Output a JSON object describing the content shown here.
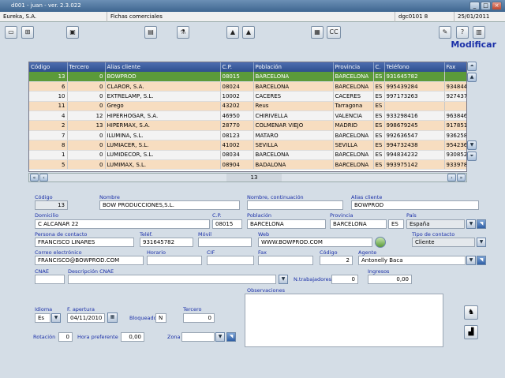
{
  "window": {
    "title": "d001 - juan - ver. 2.3.022"
  },
  "status": {
    "company": "Eureka, S.A.",
    "module": "Fichas comerciales",
    "code": "dgc0101  8",
    "date": "25/01/2011"
  },
  "toolbar": {
    "cc_label": "CC",
    "mode_label": "Modificar"
  },
  "grid": {
    "columns": [
      "Código",
      "Tercero",
      "Alias cliente",
      "C.P.",
      "Población",
      "Provincia",
      "C.",
      "Teléfono",
      "Fax"
    ],
    "rows": [
      [
        "13",
        "0",
        "BOWPROD",
        "08015",
        "BARCELONA",
        "BARCELONA",
        "ES",
        "931645782",
        ""
      ],
      [
        "6",
        "0",
        "CLAROR, S.A.",
        "08024",
        "BARCELONA",
        "BARCELONA",
        "ES",
        "995439284",
        "934844"
      ],
      [
        "10",
        "0",
        "EXTRELAMP, S.L.",
        "10002",
        "CACERES",
        "CACERES",
        "ES",
        "997173263",
        "927437"
      ],
      [
        "11",
        "0",
        "Grego",
        "43202",
        "Reus",
        "Tarragona",
        "ES",
        "",
        ""
      ],
      [
        "4",
        "12",
        "HIPERHOGAR, S.A.",
        "46950",
        "CHIRIVELLA",
        "VALENCIA",
        "ES",
        "933298416",
        "963846"
      ],
      [
        "2",
        "13",
        "HIPERMAX, S.A.",
        "28770",
        "COLMENAR VIEJO",
        "MADRID",
        "ES",
        "998679245",
        "917851"
      ],
      [
        "7",
        "0",
        "ILUMINA, S.L.",
        "08123",
        "MATARO",
        "BARCELONA",
        "ES",
        "992636547",
        "936258"
      ],
      [
        "8",
        "0",
        "LUMIACER, S.L.",
        "41002",
        "SEVILLA",
        "SEVILLA",
        "ES",
        "994732438",
        "954236"
      ],
      [
        "1",
        "0",
        "LUMIDECOR, S.L.",
        "08034",
        "BARCELONA",
        "BARCELONA",
        "ES",
        "994834232",
        "930852"
      ],
      [
        "5",
        "0",
        "LUMIMAX, S.L.",
        "08904",
        "BADALONA",
        "BARCELONA",
        "ES",
        "993975142",
        "933978"
      ]
    ],
    "pager": "13"
  },
  "form": {
    "codigo": {
      "label": "Código",
      "value": "13"
    },
    "nombre": {
      "label": "Nombre",
      "value": "BOW PRODUCCIONES,S.L."
    },
    "nombre_cont": {
      "label": "Nombre, continuación",
      "value": ""
    },
    "alias": {
      "label": "Alias cliente",
      "value": "BOWPROD"
    },
    "domicilio": {
      "label": "Domicilio",
      "value": "C ALCANAR 22"
    },
    "cp": {
      "label": "C.P.",
      "value": "08015"
    },
    "poblacion": {
      "label": "Población",
      "value": "BARCELONA"
    },
    "provincia": {
      "label": "Provincia",
      "value": "BARCELONA"
    },
    "pais_code": "ES",
    "pais": {
      "label": "País",
      "value": "España"
    },
    "contacto": {
      "label": "Persona de contacto",
      "value": "FRANCISCO LINARES"
    },
    "telef": {
      "label": "Teléf.",
      "value": "931645782"
    },
    "movil": {
      "label": "Móvil",
      "value": ""
    },
    "web": {
      "label": "Web",
      "value": "WWW.BOWPROD.COM"
    },
    "tipo_contacto": {
      "label": "Tipo de contacto",
      "value": "Cliente"
    },
    "correo": {
      "label": "Correo electrónico",
      "value": "FRANCISCO@BOWPROD.COM"
    },
    "horario": {
      "label": "Horario",
      "value": ""
    },
    "cif": {
      "label": "CIF",
      "value": ""
    },
    "fax": {
      "label": "Fax",
      "value": ""
    },
    "codigo_agente": {
      "label": "Código",
      "value": "2"
    },
    "agente": {
      "label": "Agente",
      "value": "Antonelly Baca"
    },
    "cnae": {
      "label": "CNAE",
      "value": ""
    },
    "desc_cnae": {
      "label": "Descripción CNAE",
      "value": ""
    },
    "trabajadores": {
      "label": "N.trabajadores",
      "value": "0"
    },
    "ingresos": {
      "label": "Ingresos",
      "value": "0,00"
    },
    "observaciones": {
      "label": "Observaciones",
      "value": ""
    },
    "idioma": {
      "label": "Idioma",
      "value": "Es"
    },
    "apertura": {
      "label": "F. apertura",
      "value": "04/11/2010"
    },
    "bloqueado": {
      "label": "Bloqueado",
      "value": "N"
    },
    "tercero": {
      "label": "Tercero",
      "value": "0"
    },
    "rotacion": {
      "label": "Rotación",
      "value": "0"
    },
    "hora_pref": {
      "label": "Hora preferente",
      "value": "0,00"
    },
    "zona": {
      "label": "Zona",
      "value": ""
    }
  }
}
